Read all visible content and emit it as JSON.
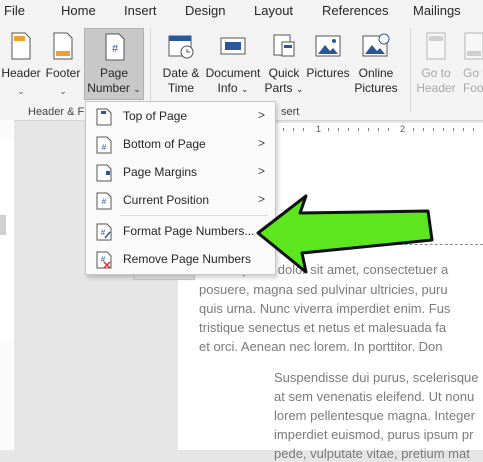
{
  "tabs": [
    "File",
    "Home",
    "Insert",
    "Design",
    "Layout",
    "References",
    "Mailings"
  ],
  "ribbon": {
    "header_label": "Header",
    "footer_label": "Footer",
    "page_number_line1": "Page",
    "page_number_line2": "Number",
    "date_time_line1": "Date &",
    "date_time_line2": "Time",
    "document_info_line1": "Document",
    "document_info_line2": "Info",
    "quick_parts_line1": "Quick",
    "quick_parts_line2": "Parts",
    "pictures_label": "Pictures",
    "online_pictures_line1": "Online",
    "online_pictures_line2": "Pictures",
    "go_to_header_line1": "Go to",
    "go_to_header_line2": "Header",
    "go_to_footer_line1": "Go to",
    "go_to_footer_line2": "Footer",
    "group_header_footer": "Header & F",
    "group_insert": "sert"
  },
  "menu": {
    "items": [
      {
        "label": "Top of Page",
        "has_submenu": true
      },
      {
        "label": "Bottom of Page",
        "has_submenu": true
      },
      {
        "label": "Page Margins",
        "has_submenu": true
      },
      {
        "label": "Current Position",
        "has_submenu": true
      },
      {
        "label": "Format Page Numbers...",
        "has_submenu": false
      },
      {
        "label": "Remove Page Numbers",
        "has_submenu": false
      }
    ]
  },
  "ruler": {
    "numbers": [
      "1",
      "2"
    ]
  },
  "document": {
    "para1": [
      "Lorem ipsum dolor sit amet, consectetuer a",
      "posuere, magna sed pulvinar ultricies, puru",
      "quis urna. Nunc viverra imperdiet enim. Fus",
      "tristique senectus et netus et malesuada fa",
      "et orci. Aenean nec lorem. In porttitor. Don"
    ],
    "para2": [
      "Suspendisse dui purus, scelerisque",
      "at sem venenatis eleifend. Ut nonu",
      "lorem pellentesque magna. Integer",
      "imperdiet euismod, purus ipsum pr",
      "pede, vulputate vitae, pretium mat"
    ]
  },
  "colors": {
    "arrow_fill": "#5ce61e",
    "arrow_stroke": "#111111",
    "icon_blue": "#2b579a"
  }
}
